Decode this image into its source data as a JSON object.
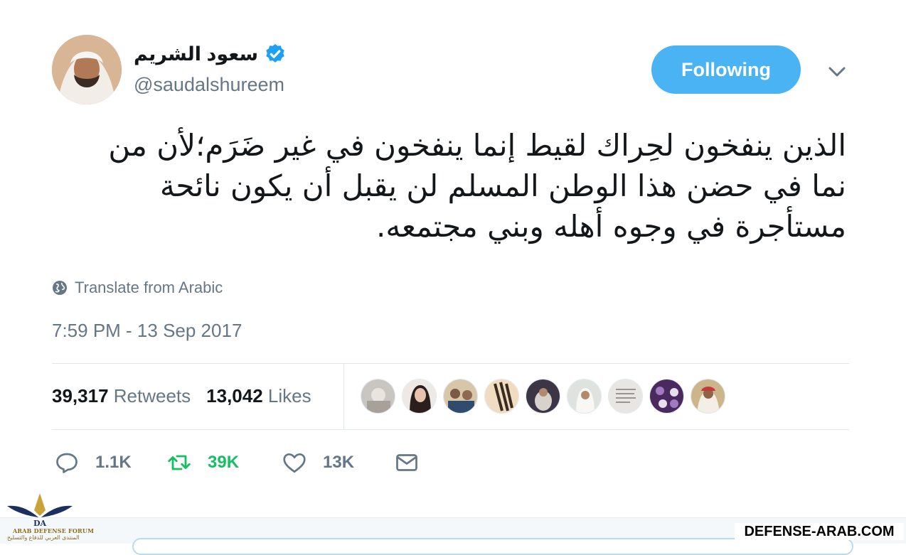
{
  "user": {
    "display_name": "سعود الشريم",
    "handle": "@saudalshureem",
    "verified": true
  },
  "header": {
    "follow_button_label": "Following",
    "menu_icon": "chevron-down-icon"
  },
  "tweet": {
    "text": "الذين ينفخون لحِراك لقيط إنما ينفخون في غير ضَرَم؛لأن من نما في حضن هذا الوطن المسلم لن يقبل أن يكون نائحة مستأجرة في وجوه أهله وبني مجتمعه.",
    "translate_label": "Translate from Arabic",
    "timestamp": "7:59 PM - 13 Sep 2017"
  },
  "stats": {
    "retweets_count": "39,317",
    "retweets_label": "Retweets",
    "likes_count": "13,042",
    "likes_label": "Likes"
  },
  "actions": {
    "reply_count": "1.1K",
    "retweet_count": "39K",
    "like_count": "13K"
  },
  "colors": {
    "accent": "#4ab3f4",
    "verified": "#1da1f2",
    "retweet_active": "#17bf63",
    "muted": "#657786"
  },
  "watermark": {
    "logo_abbr": "DA",
    "logo_title": "ARAB DEFENSE FORUM",
    "logo_subtitle": "المنتدى العربي للدفاع والتسليح",
    "site": "DEFENSE-ARAB.COM"
  }
}
